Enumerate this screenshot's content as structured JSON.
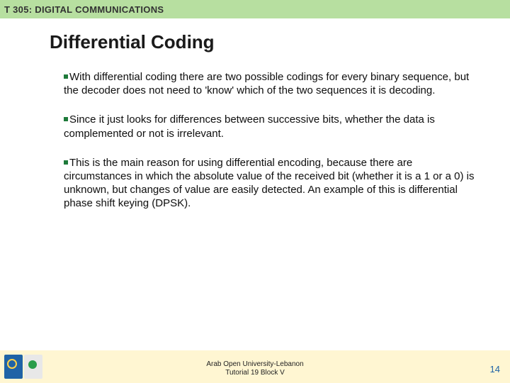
{
  "header": {
    "course_code": "T 305: DIGITAL COMMUNICATIONS"
  },
  "title": "Differential Coding",
  "paragraphs": [
    "With differential coding there are two possible codings for every binary sequence, but the decoder does not need to 'know' which of the two sequences it is decoding.",
    "Since it just looks for differences between successive bits, whether the data is complemented or not is irrelevant.",
    "This is the main reason for using differential encoding, because there are circumstances in which the absolute value of the received bit (whether it is a 1 or a 0) is unknown, but changes of value are easily detected. An example of this is differential phase shift keying (DPSK)."
  ],
  "footer": {
    "line1": "Arab Open University-Lebanon",
    "line2": "Tutorial 19 Block V"
  },
  "page_number": "14"
}
